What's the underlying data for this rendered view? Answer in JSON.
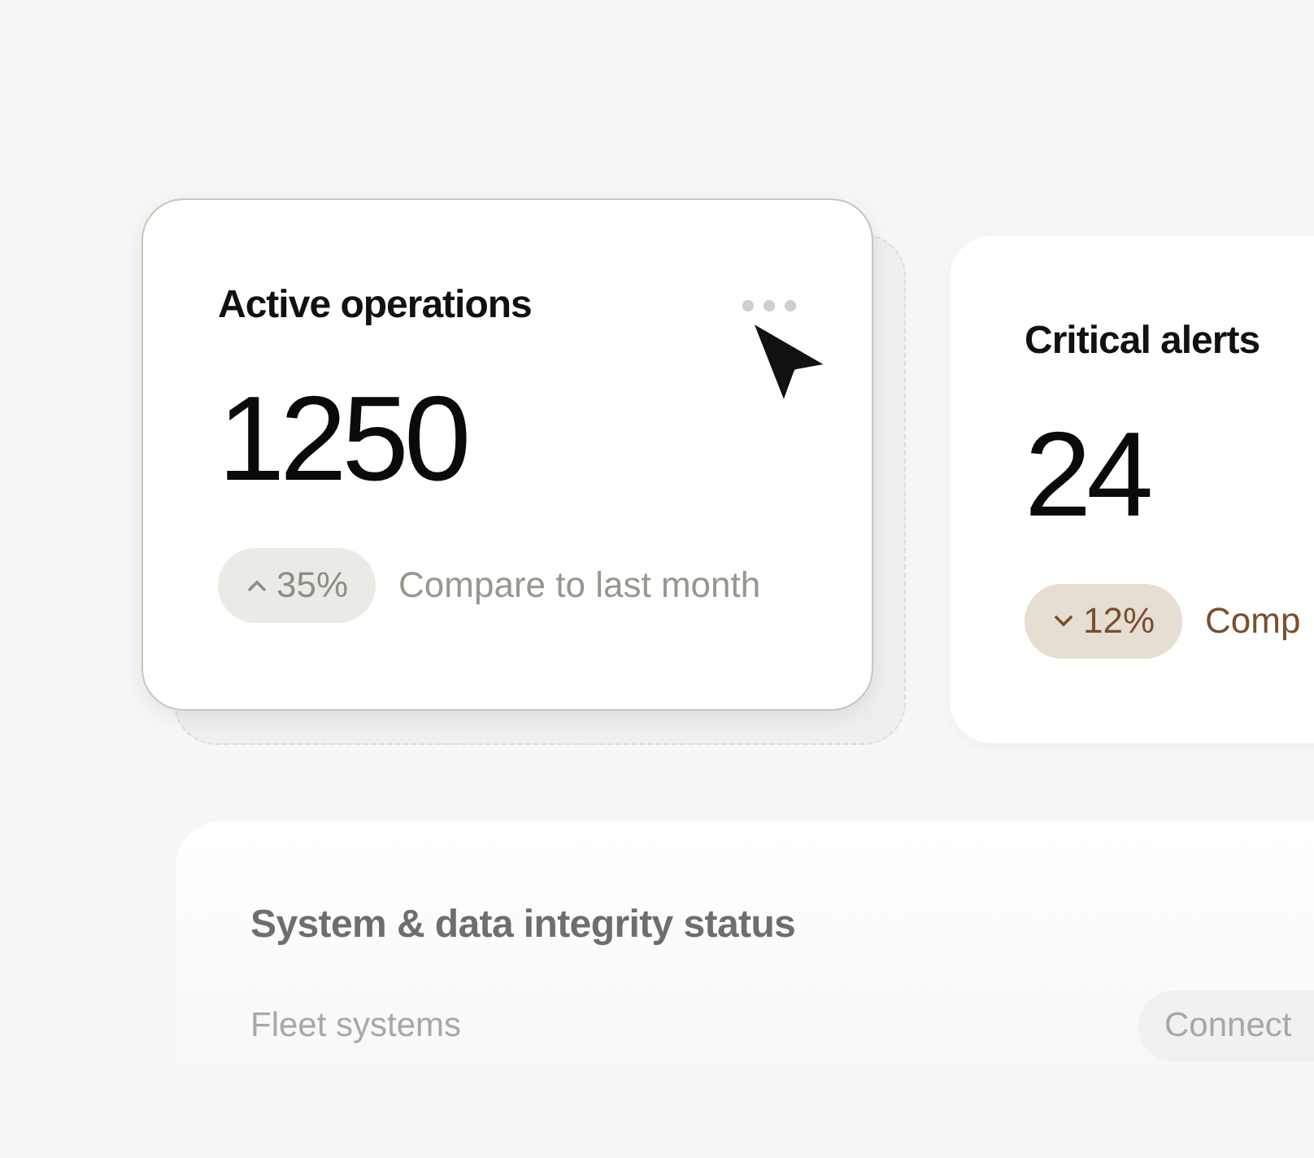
{
  "cards": [
    {
      "title": "Active operations",
      "value": "1250",
      "trend": {
        "kind": "up",
        "text": "35%"
      },
      "note": "Compare to last month",
      "selected": true
    },
    {
      "title": "Critical alerts",
      "value": "24",
      "trend": {
        "kind": "down",
        "text": "12%"
      },
      "note": "Comp",
      "selected": false
    }
  ],
  "status_panel": {
    "title": "System & data integrity status",
    "rows": [
      {
        "label": "Fleet systems",
        "status": "Connect"
      }
    ]
  }
}
